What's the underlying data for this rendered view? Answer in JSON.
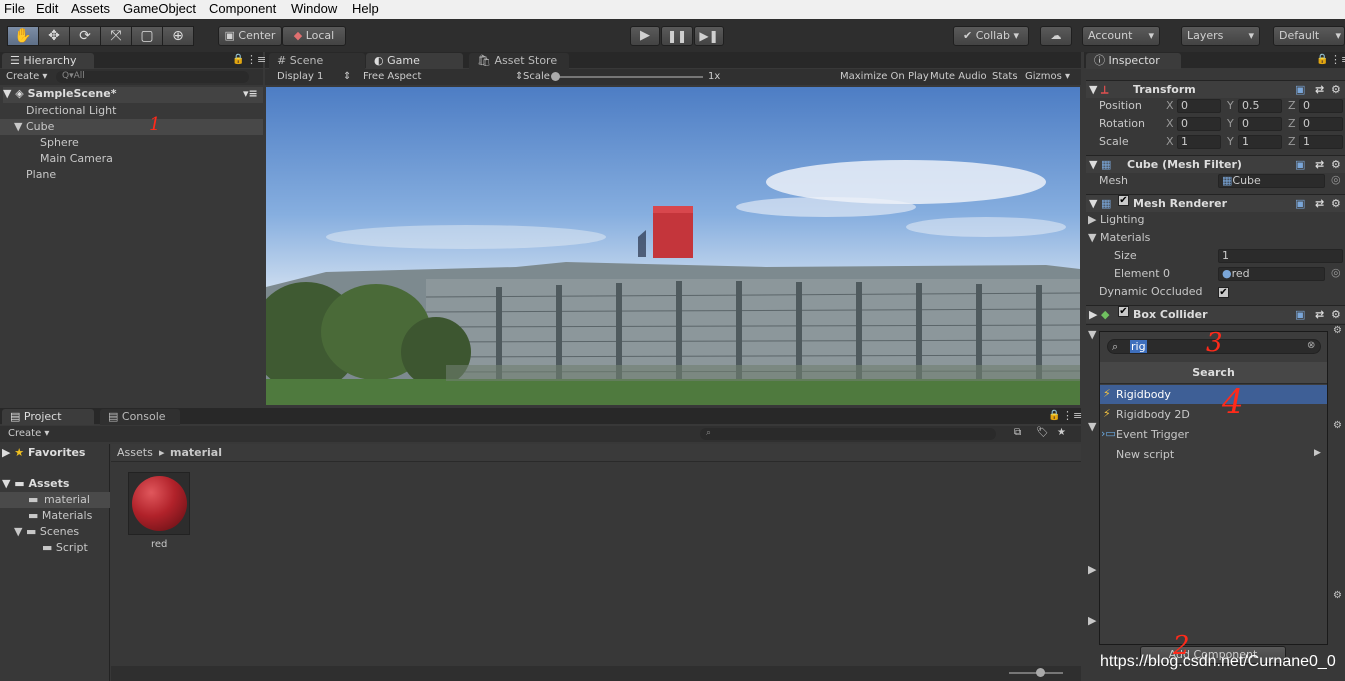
{
  "menu": [
    "File",
    "Edit",
    "Assets",
    "GameObject",
    "Component",
    "Window",
    "Help"
  ],
  "toolbar": {
    "tools": [
      {
        "name": "hand-tool",
        "glyph": "✋"
      },
      {
        "name": "move-tool",
        "glyph": "✥"
      },
      {
        "name": "rotate-tool",
        "glyph": "⟳"
      },
      {
        "name": "scale-tool",
        "glyph": "⤧"
      },
      {
        "name": "rect-tool",
        "glyph": "▢"
      },
      {
        "name": "transform-tool",
        "glyph": "⊕"
      }
    ],
    "pivot": "Center",
    "space": "Local",
    "collab": "Collab ▾",
    "account": "Account",
    "layers": "Layers",
    "layout": "Default"
  },
  "hierarchy": {
    "tab": "Hierarchy",
    "create": "Create ▾",
    "search_placeholder": "Q▾All",
    "scene": "SampleScene*",
    "items": [
      "Directional Light",
      "Cube",
      "Sphere",
      "Main Camera",
      "Plane"
    ]
  },
  "game": {
    "tabs": [
      "Scene",
      "Game",
      "Asset Store"
    ],
    "display": "Display 1",
    "aspect": "Free Aspect",
    "scale_label": "Scale",
    "scale_value": "1x",
    "options": [
      "Maximize On Play",
      "Mute Audio",
      "Stats",
      "Gizmos ▾"
    ]
  },
  "project": {
    "tabs": [
      "Project",
      "Console"
    ],
    "create": "Create ▾",
    "favorites": "Favorites",
    "assets": "Assets",
    "folders": [
      "material",
      "Materials",
      "Scenes",
      "Script"
    ],
    "breadcrumb_root": "Assets",
    "breadcrumb_current": "material",
    "asset_name": "red"
  },
  "inspector": {
    "tab": "Inspector",
    "transform": {
      "title": "Transform",
      "position_label": "Position",
      "rotation_label": "Rotation",
      "scale_label": "Scale",
      "position": [
        "0",
        "0.5",
        "0"
      ],
      "rotation": [
        "0",
        "0",
        "0"
      ],
      "scale": [
        "1",
        "1",
        "1"
      ]
    },
    "mesh_filter": {
      "title": "Cube (Mesh Filter)",
      "mesh_label": "Mesh",
      "mesh_value": "Cube"
    },
    "mesh_renderer": {
      "title": "Mesh Renderer",
      "lighting": "Lighting",
      "materials": "Materials",
      "size_label": "Size",
      "size_value": "1",
      "element_label": "Element 0",
      "element_value": "red",
      "dynamic_label": "Dynamic Occluded"
    },
    "box_collider": {
      "title": "Box Collider"
    },
    "add_component": "Add Component"
  },
  "search_popup": {
    "query": "rig",
    "title": "Search",
    "results": [
      "Rigidbody",
      "Rigidbody 2D",
      "Event Trigger",
      "New script"
    ]
  },
  "annotations": [
    "1",
    "2",
    "3",
    "4"
  ],
  "watermark": "https://blog.csdn.net/Curnane0_0",
  "colors": {
    "selected": "#3e5f96",
    "cube": "#c4353b",
    "accent": "#ff2a1a"
  }
}
